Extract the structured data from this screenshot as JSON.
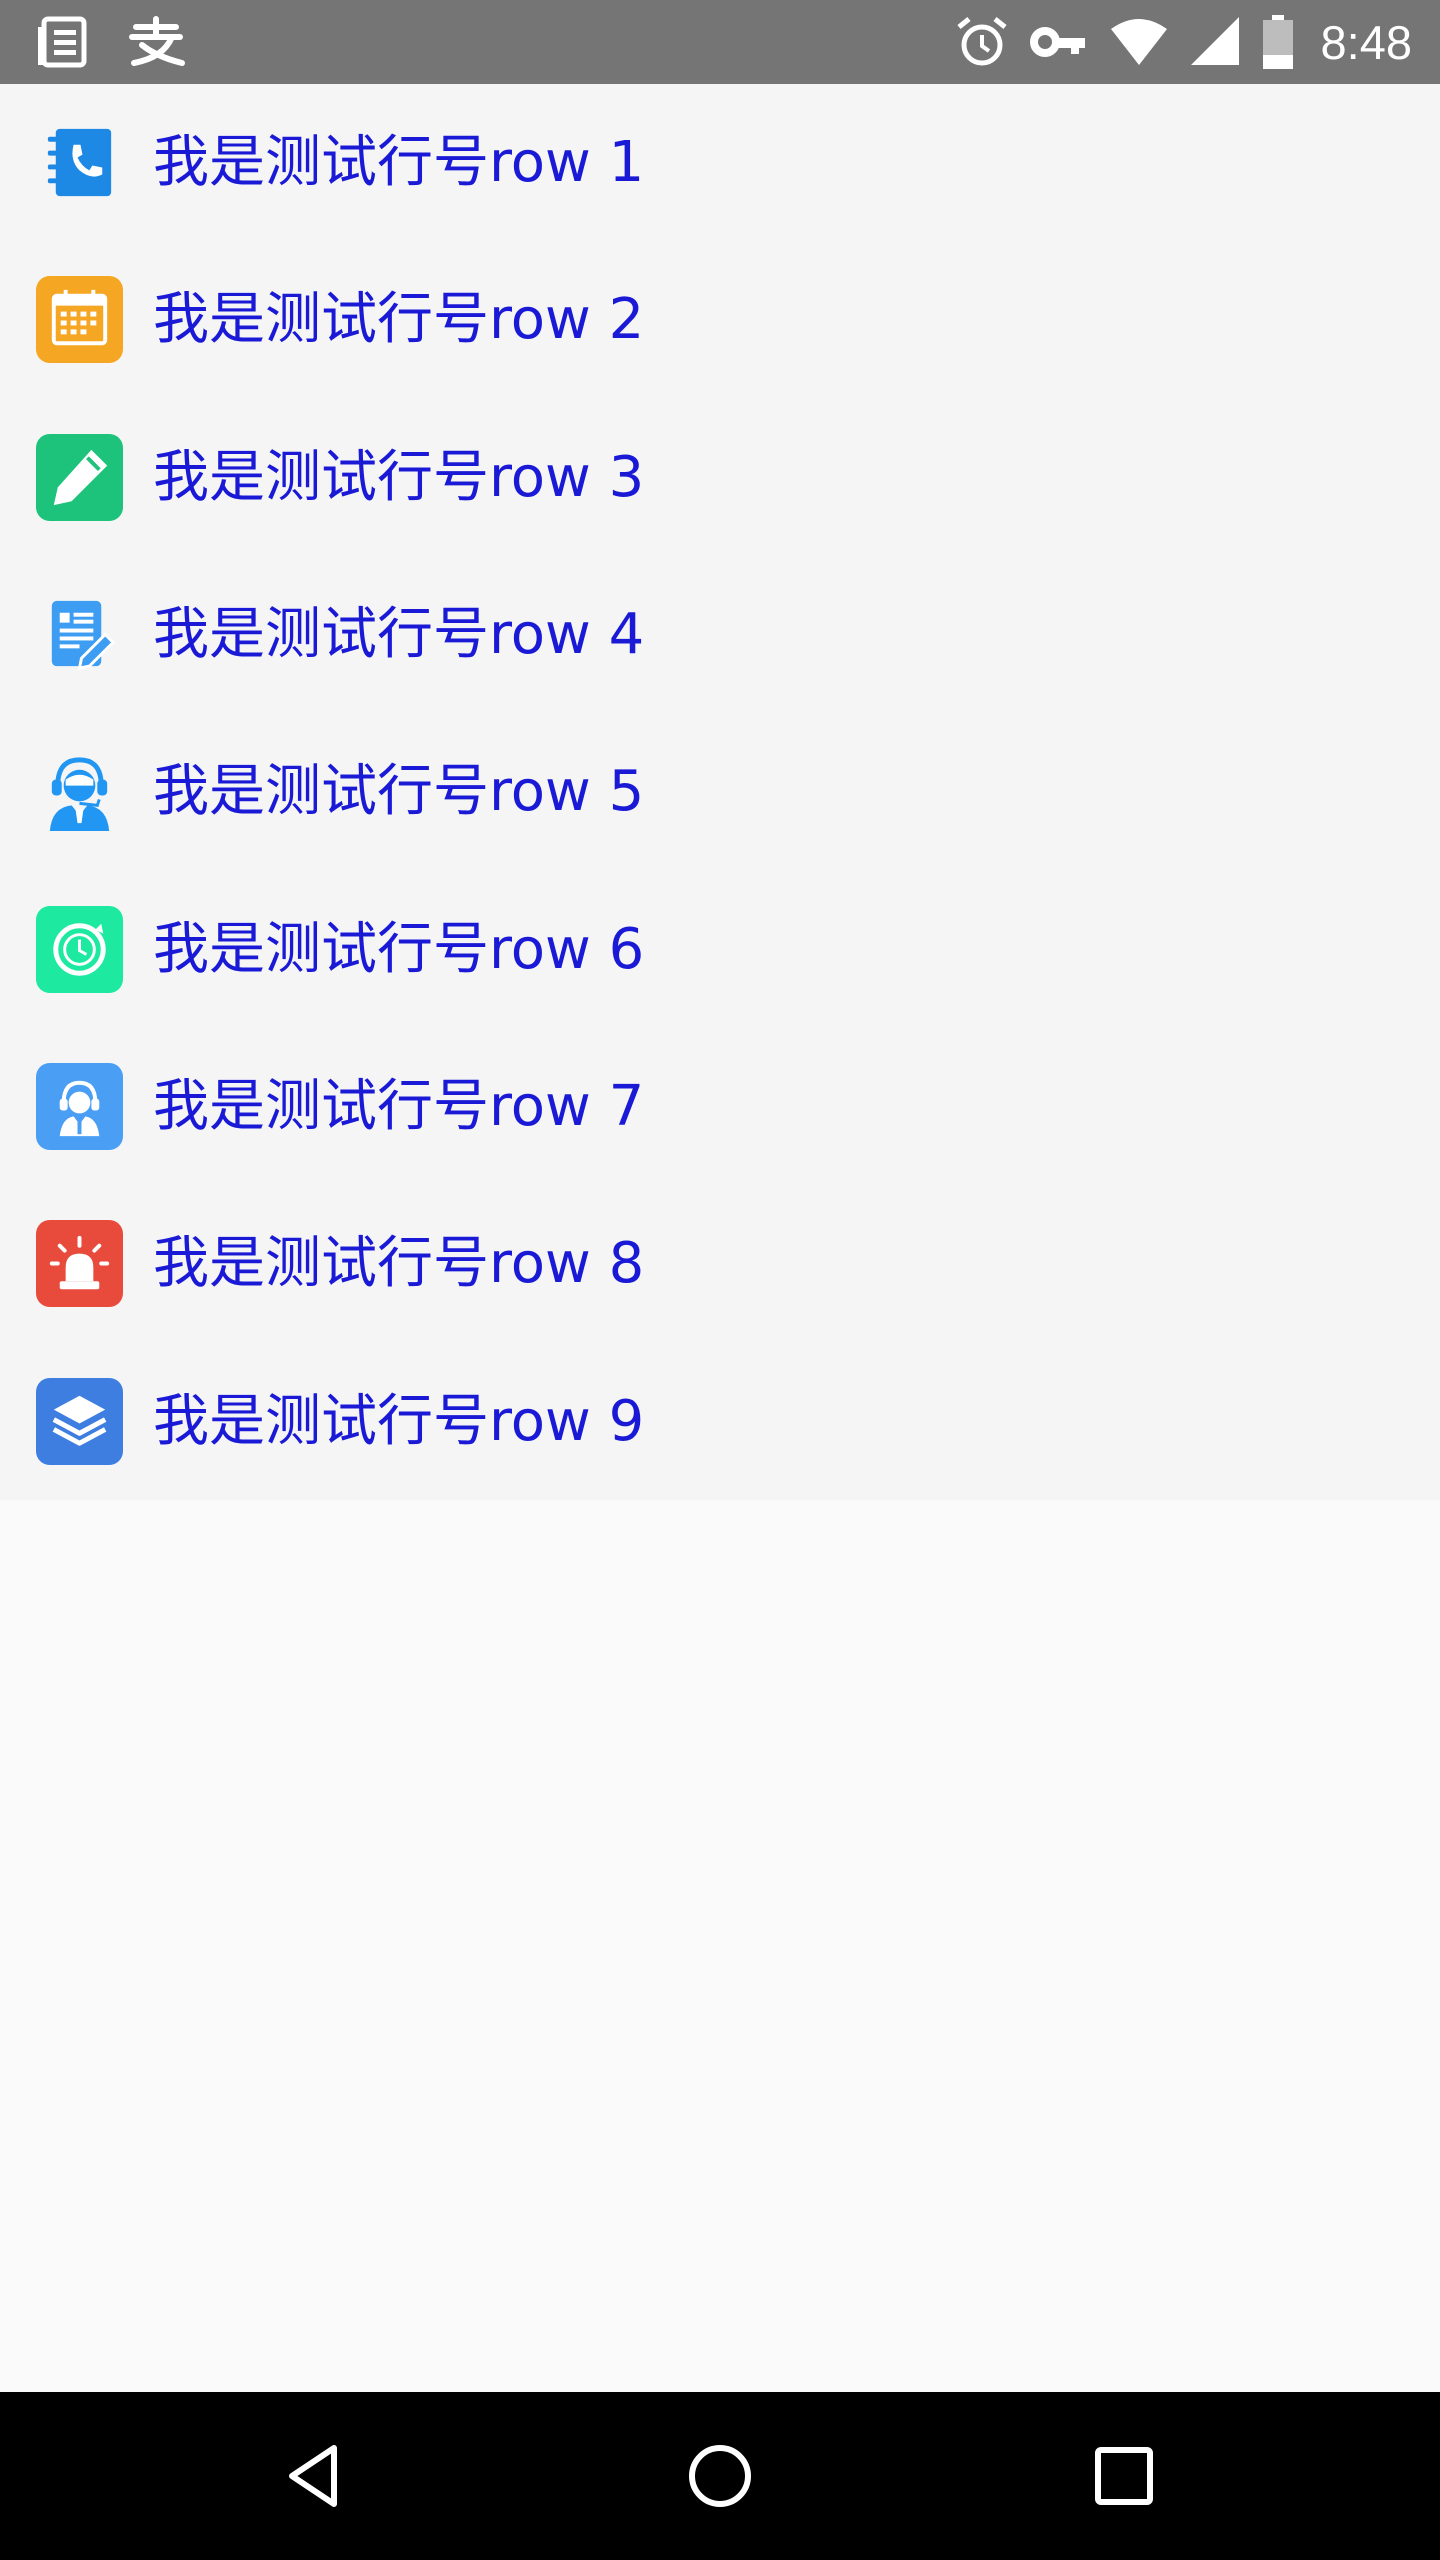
{
  "status_bar": {
    "time": "8:48",
    "left_icons": [
      "notes-icon",
      "alipay-icon"
    ],
    "right_icons": [
      "alarm-icon",
      "vpn-key-icon",
      "wifi-icon",
      "cellular-signal-icon",
      "battery-icon"
    ]
  },
  "list": {
    "rows": [
      {
        "label": "我是测试行号row 1",
        "icon": "contacts-phone-icon",
        "color": "#1e88e5"
      },
      {
        "label": "我是测试行号row 2",
        "icon": "calendar-icon",
        "color": "#f5a623"
      },
      {
        "label": "我是测试行号row 3",
        "icon": "pencil-icon",
        "color": "#1dc37a"
      },
      {
        "label": "我是测试行号row 4",
        "icon": "document-edit-icon",
        "color": "#3d9df2"
      },
      {
        "label": "我是测试行号row 5",
        "icon": "customer-service-icon",
        "color": "#2196f3"
      },
      {
        "label": "我是测试行号row 6",
        "icon": "clock-icon",
        "color": "#1de9a0"
      },
      {
        "label": "我是测试行号row 7",
        "icon": "support-agent-icon",
        "color": "#4a9ff5"
      },
      {
        "label": "我是测试行号row 8",
        "icon": "alarm-light-icon",
        "color": "#e84b3c"
      },
      {
        "label": "我是测试行号row 9",
        "icon": "layers-icon",
        "color": "#3d7ee0"
      }
    ]
  },
  "nav_bar": {
    "buttons": [
      "back-icon",
      "home-icon",
      "recents-icon"
    ]
  }
}
